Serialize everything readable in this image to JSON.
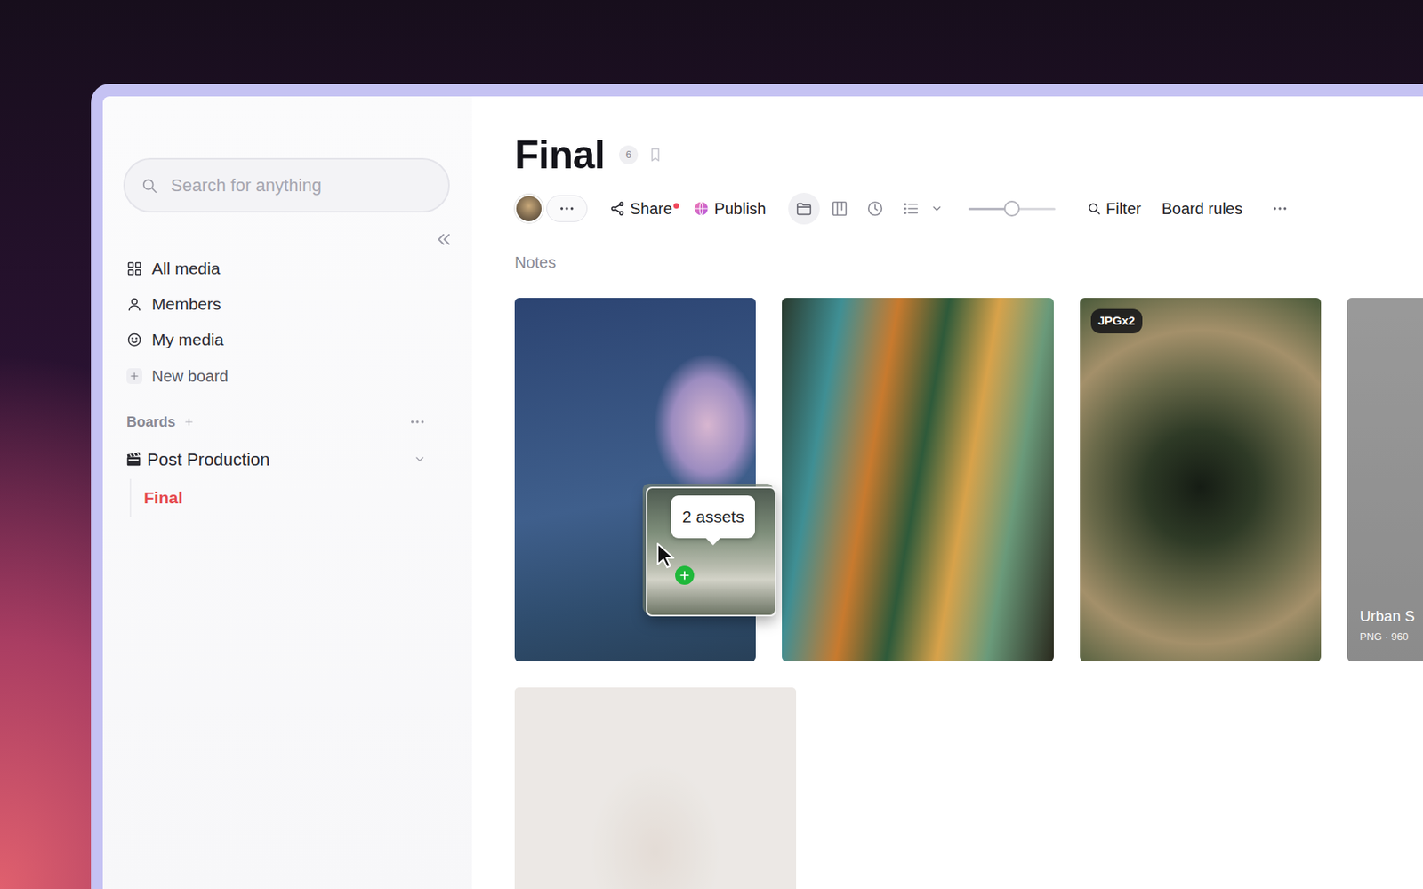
{
  "sidebar": {
    "search": {
      "placeholder": "Search for anything"
    },
    "nav": [
      {
        "label": "All media",
        "selected": false
      },
      {
        "label": "Members",
        "selected": false
      },
      {
        "label": "My media",
        "selected": false
      }
    ],
    "new_board": "New board",
    "boards_title": "Boards",
    "boards": [
      {
        "label": "Post Production",
        "expanded": true,
        "children": [
          {
            "label": "Final",
            "selected": true
          }
        ]
      }
    ]
  },
  "board": {
    "title": "Final",
    "count": "6",
    "share": {
      "label": "Share",
      "notify": true
    },
    "publish": "Publish",
    "views": [
      {
        "kind": "folder",
        "selected": true
      },
      {
        "kind": "board",
        "selected": false
      },
      {
        "kind": "clock",
        "selected": false
      },
      {
        "kind": "list",
        "selected": false
      }
    ],
    "zoom": {
      "level": 0.5
    },
    "filter": "Filter",
    "rules": "Board rules",
    "section": "Notes",
    "rows": [
      [
        {
          "faded": false
        },
        {
          "faded": false
        },
        {
          "faded": false,
          "badge": "JPGx2"
        },
        {
          "faded": true,
          "title": "Urban S",
          "meta": "PNG · 960"
        }
      ],
      [
        {
          "faded": true
        }
      ]
    ]
  },
  "drag": {
    "label": "2 assets"
  }
}
